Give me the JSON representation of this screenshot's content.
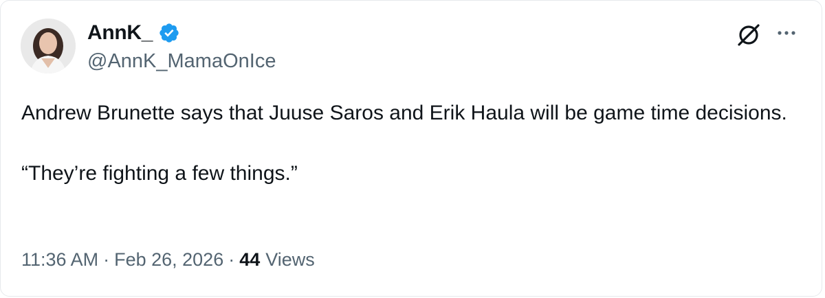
{
  "author": {
    "display_name": "AnnK_",
    "handle": "@AnnK_MamaOnIce",
    "verified": true,
    "verified_color": "#1d9bf0"
  },
  "icons": {
    "grok": "grok-slash-circle-icon",
    "more": "more-horizontal-icon",
    "verified": "verified-badge-icon"
  },
  "tweet": {
    "paragraph_1": "Andrew Brunette says that Juuse Saros and Erik Haula will be game time decisions.",
    "paragraph_2": "“They’re fighting a few things.”"
  },
  "meta": {
    "time": "11:36 AM",
    "separator": "·",
    "date": "Feb 26, 2026",
    "views_count": "44",
    "views_label": "Views"
  }
}
